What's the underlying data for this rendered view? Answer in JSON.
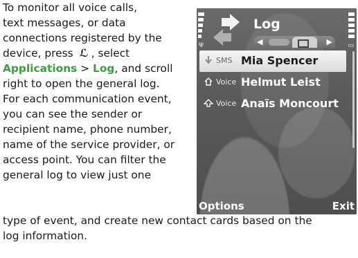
{
  "manual": {
    "line1": "To monitor all voice calls,",
    "line2": "text messages, or data",
    "line3": "connections registered by the",
    "line4_pre": "device, press",
    "line4_key": "ℒ",
    "line4_post": ", select",
    "line5_app": "Applications",
    "line5_sep": " > ",
    "line5_log": "Log",
    "line5_post": ", and scroll",
    "line6": "right to open the general log.",
    "line7": "For each communication event,",
    "line8": "you can see the sender or",
    "line9": "recipient name, phone number,",
    "line10": "name of the service provider, or",
    "line11": "access point. You can filter the",
    "line12": "general log to view just one",
    "line13": "type of event, and create new contact cards based on the",
    "line14": "log information."
  },
  "phone": {
    "title": "Log",
    "list": [
      {
        "type": "SMS",
        "name": "Mia Spencer",
        "icon": "sms-icon",
        "selected": true
      },
      {
        "type": "Voice",
        "name": "Helmut Leist",
        "icon": "incoming-call-icon",
        "selected": false
      },
      {
        "type": "Voice",
        "name": "Anaïs Moncourt",
        "icon": "outgoing-call-icon",
        "selected": false
      }
    ],
    "softkeys": {
      "left": "Options",
      "right": "Exit"
    }
  },
  "colors": {
    "accent_green": "#3aa13a",
    "screen_bg": "#5b5b5b"
  }
}
